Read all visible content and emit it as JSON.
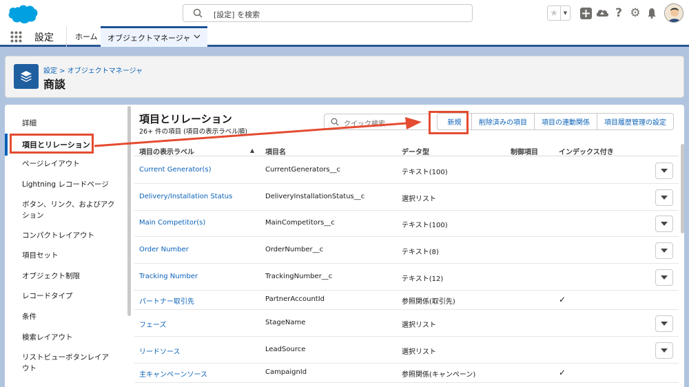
{
  "header": {
    "search_placeholder": "[設定] を検索",
    "icons": [
      "star-icon",
      "plus-icon",
      "cloud-icon",
      "help-icon",
      "gear-icon",
      "bell-icon",
      "avatar"
    ]
  },
  "app_bar": {
    "app_name": "設定",
    "tabs": [
      {
        "label": "ホーム"
      },
      {
        "label": "オブジェクトマネージャ"
      }
    ]
  },
  "page_header": {
    "breadcrumb": "設定 > オブジェクトマネージャ",
    "title": "商談"
  },
  "sidebar": {
    "items": [
      {
        "label": "詳細"
      },
      {
        "label": "項目とリレーション"
      },
      {
        "label": "ページレイアウト"
      },
      {
        "label": "Lightning レコードページ"
      },
      {
        "label": "ボタン、リンク、およびアクション"
      },
      {
        "label": "コンパクトレイアウト"
      },
      {
        "label": "項目セット"
      },
      {
        "label": "オブジェクト制限"
      },
      {
        "label": "レコードタイプ"
      },
      {
        "label": "条件"
      },
      {
        "label": "検索レイアウト"
      },
      {
        "label": "リストビューボタンレイアウト"
      }
    ]
  },
  "panel": {
    "title": "項目とリレーション",
    "subtitle": "26+ 件の項目 (項目の表示ラベル順)",
    "quick_search_placeholder": "クイック検索",
    "buttons": [
      "新規",
      "削除済みの項目",
      "項目の連動関係",
      "項目履歴管理の設定"
    ]
  },
  "table": {
    "columns": [
      "項目の表示ラベル",
      "項目名",
      "データ型",
      "制御項目",
      "インデックス付き"
    ],
    "sort_indicator": "▲",
    "rows": [
      {
        "label": "Current Generator(s)",
        "api": "CurrentGenerators__c",
        "type": "テキスト(100)",
        "indexed": "",
        "has_menu": true
      },
      {
        "label": "Delivery/Installation Status",
        "api": "DeliveryInstallationStatus__c",
        "type": "選択リスト",
        "indexed": "",
        "has_menu": true
      },
      {
        "label": "Main Competitor(s)",
        "api": "MainCompetitors__c",
        "type": "テキスト(100)",
        "indexed": "",
        "has_menu": true
      },
      {
        "label": "Order Number",
        "api": "OrderNumber__c",
        "type": "テキスト(8)",
        "indexed": "",
        "has_menu": true
      },
      {
        "label": "Tracking Number",
        "api": "TrackingNumber__c",
        "type": "テキスト(12)",
        "indexed": "",
        "has_menu": true
      },
      {
        "label": "パートナー取引先",
        "api": "PartnerAccountId",
        "type": "参照関係(取引先)",
        "indexed": "✓",
        "has_menu": false
      },
      {
        "label": "フェーズ",
        "api": "StageName",
        "type": "選択リスト",
        "indexed": "",
        "has_menu": true
      },
      {
        "label": "リードソース",
        "api": "LeadSource",
        "type": "選択リスト",
        "indexed": "",
        "has_menu": true
      },
      {
        "label": "主キャンペーンソース",
        "api": "CampaignId",
        "type": "参照関係(キャンペーン)",
        "indexed": "✓",
        "has_menu": false
      }
    ]
  },
  "colors": {
    "accent": "#0b62b8",
    "annotation": "#e44b30",
    "brand_header": "#2a5595"
  }
}
